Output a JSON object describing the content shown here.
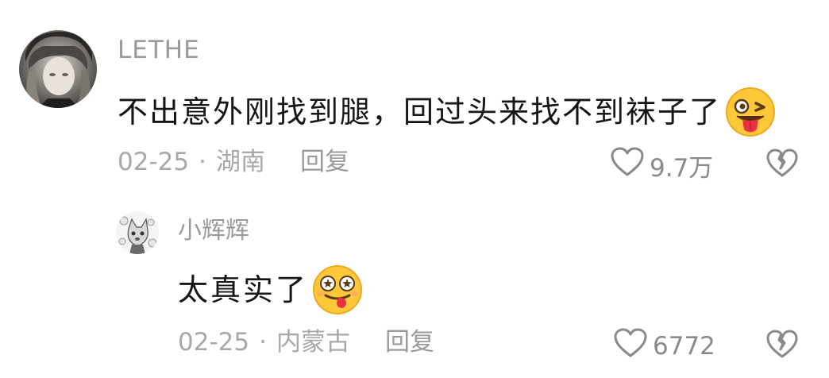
{
  "comments": [
    {
      "username": "LETHE",
      "text": "不出意外刚找到腿，回过头来找不到袜子了",
      "emoji": "wink-tongue-emoji",
      "date": "02-25",
      "location": "湖南",
      "reply_label": "回复",
      "likes": "9.7万"
    },
    {
      "username": "小辉辉",
      "text": "太真实了",
      "emoji": "dizzy-eyes-tongue-emoji",
      "date": "02-25",
      "location": "内蒙古",
      "reply_label": "回复",
      "likes": "6772"
    }
  ],
  "separator": "·",
  "colors": {
    "meta_text": "#a8a8a8",
    "body_text": "#161616",
    "emoji_yellow": "#ffc83a",
    "tongue_red": "#e9303f"
  }
}
